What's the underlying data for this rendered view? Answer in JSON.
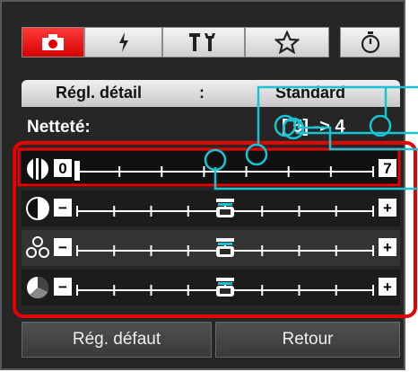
{
  "header": {
    "label": "Régl. détail",
    "separator": ":",
    "value": "Standard"
  },
  "sharpness": {
    "label": "Netteté:",
    "value_from": "5",
    "arrow": "->",
    "value_to": "4"
  },
  "sliders": [
    {
      "name": "sharpness",
      "min_label": "0",
      "max_label": "7",
      "ticks": 8,
      "value": 0
    },
    {
      "name": "contrast",
      "min_label": "−",
      "max_label": "+",
      "ticks": 9,
      "value": 4
    },
    {
      "name": "saturation",
      "min_label": "−",
      "max_label": "+",
      "ticks": 9,
      "value": 4
    },
    {
      "name": "color-tone",
      "min_label": "−",
      "max_label": "+",
      "ticks": 9,
      "value": 4
    }
  ],
  "buttons": {
    "default": "Rég. défaut",
    "back": "Retour"
  },
  "colors": {
    "active_tab": "#e00000",
    "highlight": "#e60000",
    "callout": "#18c4d4"
  },
  "icons": {
    "tab_shoot": "camera-icon",
    "tab_flash": "flash-icon",
    "tab_tools": "tools-icon",
    "tab_mymenu": "star-icon",
    "timer": "timer-icon"
  }
}
